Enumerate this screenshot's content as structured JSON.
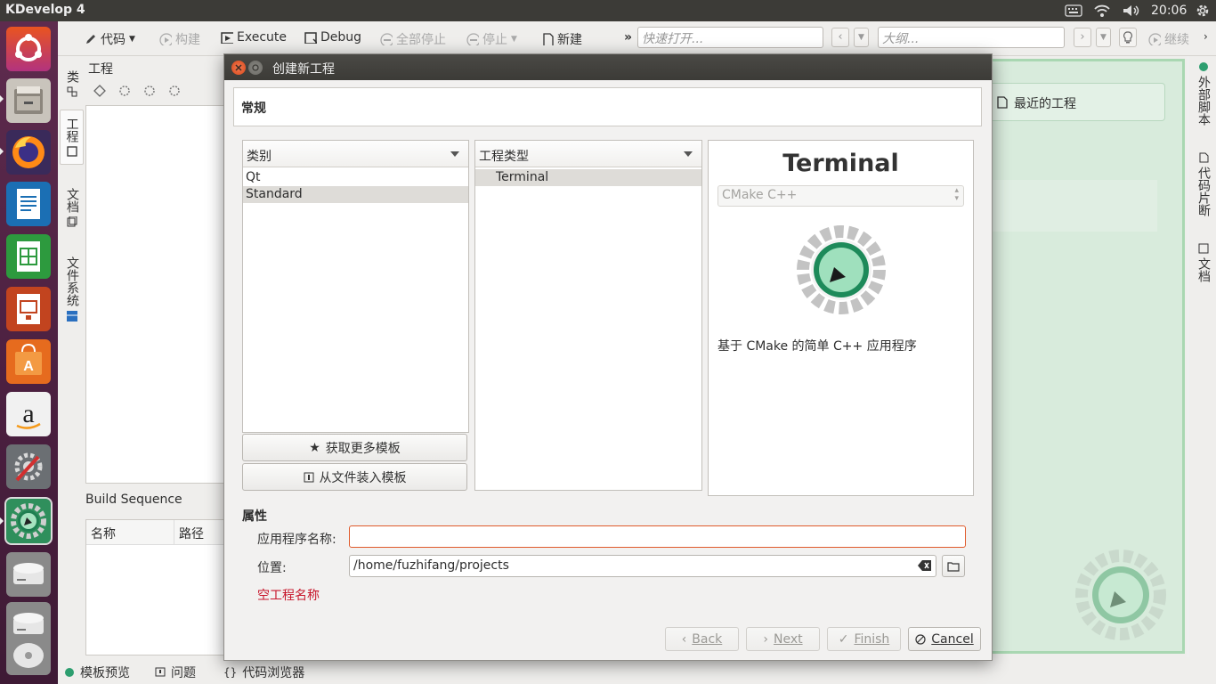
{
  "top_panel": {
    "app_title": "KDevelop 4",
    "clock": "20:06"
  },
  "launcher": {
    "items": [
      "ubuntu-dash",
      "files",
      "firefox",
      "libreoffice-writer",
      "libreoffice-calc",
      "libreoffice-impress",
      "software-center",
      "amazon",
      "system-settings",
      "kdevelop",
      "disk-1",
      "disk-2",
      "disk-3"
    ]
  },
  "toolbar": {
    "code": "代码",
    "build": "构建",
    "execute": "Execute",
    "debug": "Debug",
    "stop_all": "全部停止",
    "stop": "停止",
    "new": "新建",
    "quick_open_placeholder": "快速打开...",
    "outline_placeholder": "大纲...",
    "continue": "继续"
  },
  "left_dock": {
    "tabs": [
      "类",
      "工程",
      "文档",
      "文件系统"
    ],
    "panel_title": "工程",
    "build_sequence_title": "Build Sequence",
    "build_sequence_columns": [
      "名称",
      "路径"
    ]
  },
  "right_dock": {
    "tabs": [
      "外部脚本",
      "代码片断",
      "文档"
    ],
    "recent_projects": "最近的工程"
  },
  "status_bar": {
    "items": [
      "模板预览",
      "问题",
      "代码浏览器"
    ]
  },
  "dialog": {
    "title": "创建新工程",
    "section": "常规",
    "category_combo": "类别",
    "categories": [
      "Qt",
      "Standard"
    ],
    "selected_category": "Standard",
    "project_type_combo": "工程类型",
    "project_types": [
      "Terminal"
    ],
    "get_more_templates": "获取更多模板",
    "load_template_from_file": "从文件装入模板",
    "preview": {
      "title": "Terminal",
      "build_system": "CMake C++",
      "description": "基于 CMake 的简单 C++ 应用程序"
    },
    "properties_heading": "属性",
    "app_name_label": "应用程序名称:",
    "app_name_value": "",
    "location_label": "位置:",
    "location_value": "/home/fuzhifang/projects",
    "error_text": "空工程名称",
    "buttons": {
      "back": "Back",
      "next": "Next",
      "finish": "Finish",
      "cancel": "Cancel"
    }
  },
  "colors": {
    "accent_error": "#c7162b",
    "input_focus_border": "#e05a2b",
    "kdevelop_green": "#2d9e6f",
    "dock_green": "#a9d7b2"
  }
}
